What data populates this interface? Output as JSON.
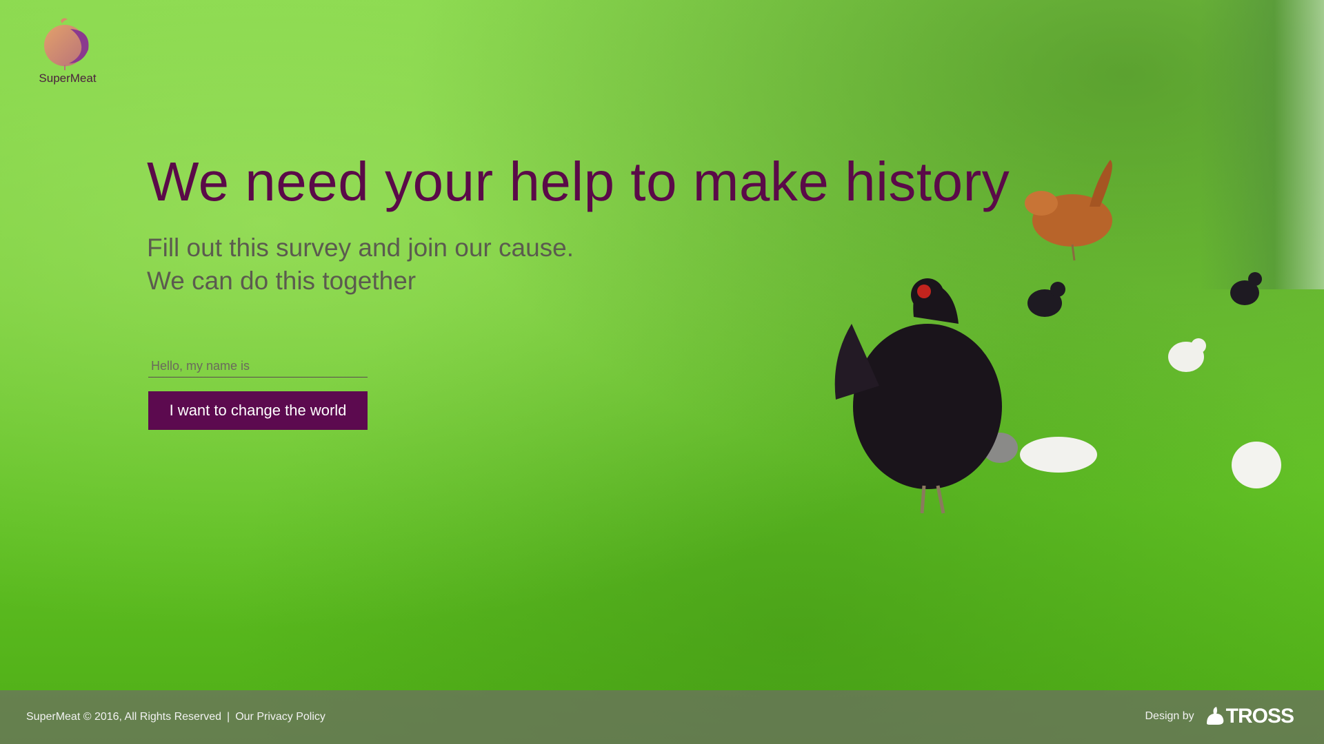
{
  "brand": {
    "name": "SuperMeat"
  },
  "hero": {
    "headline": "We need your help to make history",
    "subline_1": "Fill out this survey and join our cause.",
    "subline_2": "We can do this together"
  },
  "form": {
    "name_placeholder": "Hello, my name is",
    "name_value": "",
    "submit_label": "I want to change the world"
  },
  "footer": {
    "copyright": "SuperMeat © 2016, All Rights Reserved",
    "separator": "|",
    "privacy_link": "Our Privacy Policy",
    "design_by": "Design by",
    "designer_logo_text": "TROSS"
  },
  "colors": {
    "brand_purple": "#5c0a4f",
    "headline": "#5a0a48",
    "grass": "#74cc36",
    "footer_bg": "#6e6e64"
  }
}
